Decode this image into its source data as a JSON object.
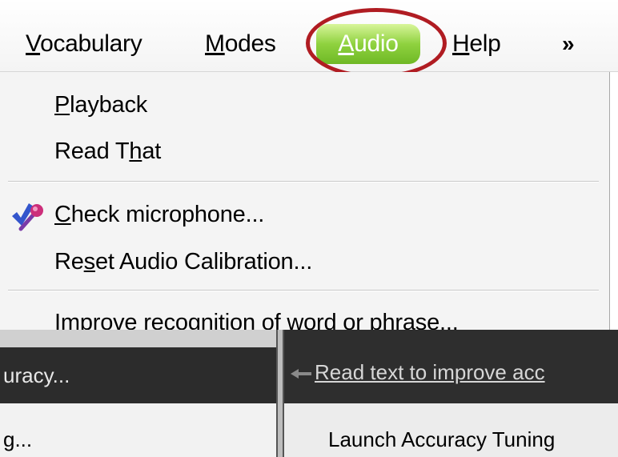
{
  "menubar": {
    "items": [
      {
        "before": "",
        "mnemonic": "V",
        "after": "ocabulary"
      },
      {
        "before": "",
        "mnemonic": "M",
        "after": "odes"
      },
      {
        "before": "",
        "mnemonic": "A",
        "after": "udio"
      },
      {
        "before": "",
        "mnemonic": "H",
        "after": "elp"
      }
    ],
    "more_glyph": "»"
  },
  "dropdown": {
    "items": [
      {
        "before": "",
        "mnemonic": "P",
        "after": "layback"
      },
      {
        "before": "Read T",
        "mnemonic": "h",
        "after": "at"
      },
      {
        "before": "",
        "mnemonic": "C",
        "after": "heck microphone..."
      },
      {
        "before": "Re",
        "mnemonic": "s",
        "after": "et Audio Calibration..."
      },
      {
        "before": "",
        "mnemonic": "I",
        "after": "mprove recognition of word or phrase..."
      }
    ],
    "mic_icon": "microphone-check-icon"
  },
  "background": {
    "left_dark_text": "uracy...",
    "left_light_text": "g...",
    "right_dark_text": "Read text to improve acc",
    "right_light_text": "Launch Accuracy Tuning"
  },
  "colors": {
    "audio_highlight_green": "#8fd23f",
    "annotation_red": "#b01c22",
    "menu_background": "#f4f4f4"
  }
}
